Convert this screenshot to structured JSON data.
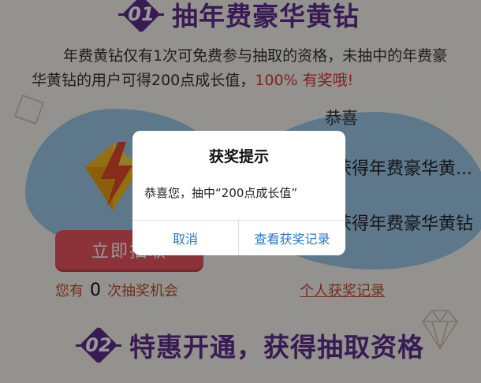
{
  "section1": {
    "number": "01",
    "title": "抽年费豪华黄钻"
  },
  "description": {
    "text": "年费黄钻仅有1次可免费参与抽取的资格，未抽中的年费豪华黄钻的用户可得200点成长值，",
    "highlight": "100% 有奖哦!"
  },
  "draw_button": {
    "label": "立即抽取"
  },
  "chances": {
    "prefix": "您有",
    "count": "0",
    "suffix": "次抽奖机会"
  },
  "winners": {
    "title": "恭喜",
    "lines": [
      "获得年费豪华黄...",
      "获得年费豪华黄钻"
    ]
  },
  "my_record": {
    "label": "个人获奖记录"
  },
  "section2": {
    "number": "02",
    "title": "特惠开通，获得抽取资格"
  },
  "modal": {
    "title": "获奖提示",
    "message": "恭喜您，抽中“200点成长值”",
    "cancel_label": "取消",
    "view_label": "查看获奖记录"
  },
  "colors": {
    "accent_purple": "#5e2d8a",
    "button_red": "#e85560",
    "link_blue": "#2a78c8",
    "blob_blue": "#9cc8e8"
  }
}
